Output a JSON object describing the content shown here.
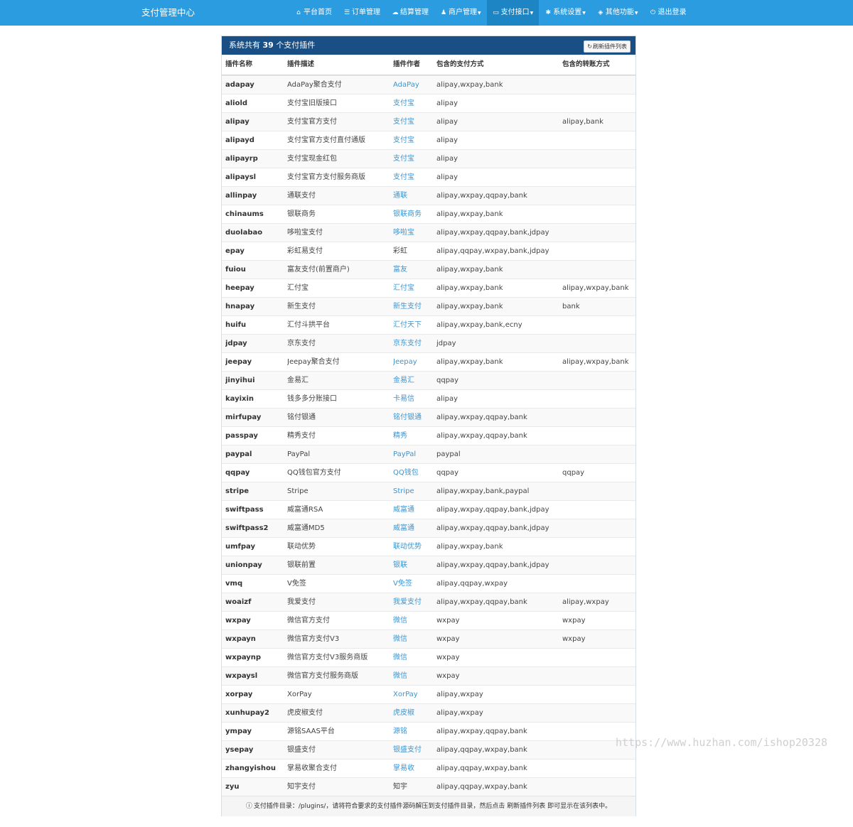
{
  "brand": "支付管理中心",
  "nav": [
    {
      "icon": "home-icon",
      "glyph": "⌂",
      "label": "平台首页",
      "dropdown": false
    },
    {
      "icon": "list-icon",
      "glyph": "☰",
      "label": "订单管理",
      "dropdown": false
    },
    {
      "icon": "cloud-icon",
      "glyph": "☁",
      "label": "结算管理",
      "dropdown": false
    },
    {
      "icon": "user-icon",
      "glyph": "♟",
      "label": "商户管理",
      "dropdown": true
    },
    {
      "icon": "credit-card-icon",
      "glyph": "▭",
      "label": "支付接口",
      "dropdown": true,
      "active": true
    },
    {
      "icon": "gear-icon",
      "glyph": "✱",
      "label": "系统设置",
      "dropdown": true
    },
    {
      "icon": "cube-icon",
      "glyph": "◈",
      "label": "其他功能",
      "dropdown": true
    },
    {
      "icon": "power-icon",
      "glyph": "⏻",
      "label": "退出登录",
      "dropdown": false
    }
  ],
  "panel": {
    "title_prefix": "系统共有",
    "count": "39",
    "title_suffix": "个支付插件",
    "refresh_label": "刷新插件列表"
  },
  "table": {
    "headers": [
      "插件名称",
      "插件描述",
      "插件作者",
      "包含的支付方式",
      "包含的转账方式"
    ],
    "rows": [
      {
        "name": "adapay",
        "desc": "AdaPay聚合支付",
        "author": "AdaPay",
        "link": true,
        "pay": "alipay,wxpay,bank",
        "transfer": ""
      },
      {
        "name": "aliold",
        "desc": "支付宝旧版接口",
        "author": "支付宝",
        "link": true,
        "pay": "alipay",
        "transfer": ""
      },
      {
        "name": "alipay",
        "desc": "支付宝官方支付",
        "author": "支付宝",
        "link": true,
        "pay": "alipay",
        "transfer": "alipay,bank"
      },
      {
        "name": "alipayd",
        "desc": "支付宝官方支付直付通版",
        "author": "支付宝",
        "link": true,
        "pay": "alipay",
        "transfer": ""
      },
      {
        "name": "alipayrp",
        "desc": "支付宝现金红包",
        "author": "支付宝",
        "link": true,
        "pay": "alipay",
        "transfer": ""
      },
      {
        "name": "alipaysl",
        "desc": "支付宝官方支付服务商版",
        "author": "支付宝",
        "link": true,
        "pay": "alipay",
        "transfer": ""
      },
      {
        "name": "allinpay",
        "desc": "通联支付",
        "author": "通联",
        "link": true,
        "pay": "alipay,wxpay,qqpay,bank",
        "transfer": ""
      },
      {
        "name": "chinaums",
        "desc": "银联商务",
        "author": "银联商务",
        "link": true,
        "pay": "alipay,wxpay,bank",
        "transfer": ""
      },
      {
        "name": "duolabao",
        "desc": "哆啦宝支付",
        "author": "哆啦宝",
        "link": true,
        "pay": "alipay,wxpay,qqpay,bank,jdpay",
        "transfer": ""
      },
      {
        "name": "epay",
        "desc": "彩虹易支付",
        "author": "彩虹",
        "link": false,
        "pay": "alipay,qqpay,wxpay,bank,jdpay",
        "transfer": ""
      },
      {
        "name": "fuiou",
        "desc": "富友支付(前置商户)",
        "author": "富友",
        "link": true,
        "pay": "alipay,wxpay,bank",
        "transfer": ""
      },
      {
        "name": "heepay",
        "desc": "汇付宝",
        "author": "汇付宝",
        "link": true,
        "pay": "alipay,wxpay,bank",
        "transfer": "alipay,wxpay,bank"
      },
      {
        "name": "hnapay",
        "desc": "新生支付",
        "author": "新生支付",
        "link": true,
        "pay": "alipay,wxpay,bank",
        "transfer": "bank"
      },
      {
        "name": "huifu",
        "desc": "汇付斗拱平台",
        "author": "汇付天下",
        "link": true,
        "pay": "alipay,wxpay,bank,ecny",
        "transfer": ""
      },
      {
        "name": "jdpay",
        "desc": "京东支付",
        "author": "京东支付",
        "link": true,
        "pay": "jdpay",
        "transfer": ""
      },
      {
        "name": "jeepay",
        "desc": "Jeepay聚合支付",
        "author": "Jeepay",
        "link": true,
        "pay": "alipay,wxpay,bank",
        "transfer": "alipay,wxpay,bank"
      },
      {
        "name": "jinyihui",
        "desc": "金易汇",
        "author": "金易汇",
        "link": true,
        "pay": "qqpay",
        "transfer": ""
      },
      {
        "name": "kayixin",
        "desc": "钱多多分账接口",
        "author": "卡易信",
        "link": true,
        "pay": "alipay",
        "transfer": ""
      },
      {
        "name": "mirfupay",
        "desc": "铭付银通",
        "author": "铭付银通",
        "link": true,
        "pay": "alipay,wxpay,qqpay,bank",
        "transfer": ""
      },
      {
        "name": "passpay",
        "desc": "精秀支付",
        "author": "精秀",
        "link": true,
        "pay": "alipay,wxpay,qqpay,bank",
        "transfer": ""
      },
      {
        "name": "paypal",
        "desc": "PayPal",
        "author": "PayPal",
        "link": true,
        "pay": "paypal",
        "transfer": ""
      },
      {
        "name": "qqpay",
        "desc": "QQ钱包官方支付",
        "author": "QQ钱包",
        "link": true,
        "pay": "qqpay",
        "transfer": "qqpay"
      },
      {
        "name": "stripe",
        "desc": "Stripe",
        "author": "Stripe",
        "link": true,
        "pay": "alipay,wxpay,bank,paypal",
        "transfer": ""
      },
      {
        "name": "swiftpass",
        "desc": "威富通RSA",
        "author": "威富通",
        "link": true,
        "pay": "alipay,wxpay,qqpay,bank,jdpay",
        "transfer": ""
      },
      {
        "name": "swiftpass2",
        "desc": "威富通MD5",
        "author": "威富通",
        "link": true,
        "pay": "alipay,wxpay,qqpay,bank,jdpay",
        "transfer": ""
      },
      {
        "name": "umfpay",
        "desc": "联动优势",
        "author": "联动优势",
        "link": true,
        "pay": "alipay,wxpay,bank",
        "transfer": ""
      },
      {
        "name": "unionpay",
        "desc": "银联前置",
        "author": "银联",
        "link": true,
        "pay": "alipay,wxpay,qqpay,bank,jdpay",
        "transfer": ""
      },
      {
        "name": "vmq",
        "desc": "V免签",
        "author": "V免签",
        "link": true,
        "pay": "alipay,qqpay,wxpay",
        "transfer": ""
      },
      {
        "name": "woaizf",
        "desc": "我爱支付",
        "author": "我爱支付",
        "link": true,
        "pay": "alipay,wxpay,qqpay,bank",
        "transfer": "alipay,wxpay"
      },
      {
        "name": "wxpay",
        "desc": "微信官方支付",
        "author": "微信",
        "link": true,
        "pay": "wxpay",
        "transfer": "wxpay"
      },
      {
        "name": "wxpayn",
        "desc": "微信官方支付V3",
        "author": "微信",
        "link": true,
        "pay": "wxpay",
        "transfer": "wxpay"
      },
      {
        "name": "wxpaynp",
        "desc": "微信官方支付V3服务商版",
        "author": "微信",
        "link": true,
        "pay": "wxpay",
        "transfer": ""
      },
      {
        "name": "wxpaysl",
        "desc": "微信官方支付服务商版",
        "author": "微信",
        "link": true,
        "pay": "wxpay",
        "transfer": ""
      },
      {
        "name": "xorpay",
        "desc": "XorPay",
        "author": "XorPay",
        "link": true,
        "pay": "alipay,wxpay",
        "transfer": ""
      },
      {
        "name": "xunhupay2",
        "desc": "虎皮椒支付",
        "author": "虎皮椒",
        "link": true,
        "pay": "alipay,wxpay",
        "transfer": ""
      },
      {
        "name": "ympay",
        "desc": "源铭SAAS平台",
        "author": "源铭",
        "link": true,
        "pay": "alipay,wxpay,qqpay,bank",
        "transfer": ""
      },
      {
        "name": "ysepay",
        "desc": "银盛支付",
        "author": "银盛支付",
        "link": true,
        "pay": "alipay,qqpay,wxpay,bank",
        "transfer": ""
      },
      {
        "name": "zhangyishou",
        "desc": "掌易收聚合支付",
        "author": "掌易收",
        "link": true,
        "pay": "alipay,qqpay,wxpay,bank",
        "transfer": ""
      },
      {
        "name": "zyu",
        "desc": "知宇支付",
        "author": "知宇",
        "link": false,
        "pay": "alipay,qqpay,wxpay,bank",
        "transfer": ""
      }
    ]
  },
  "footer_note": "支付插件目录：/plugins/，请将符合要求的支付插件源码解压到支付插件目录，然后点击 刷新插件列表 即可显示在该列表中。",
  "watermark": "https://www.huzhan.com/ishop20328",
  "colors": {
    "navbar": "#2b9ce0",
    "panel_heading": "#1a4f86",
    "link": "#3a96d2"
  }
}
